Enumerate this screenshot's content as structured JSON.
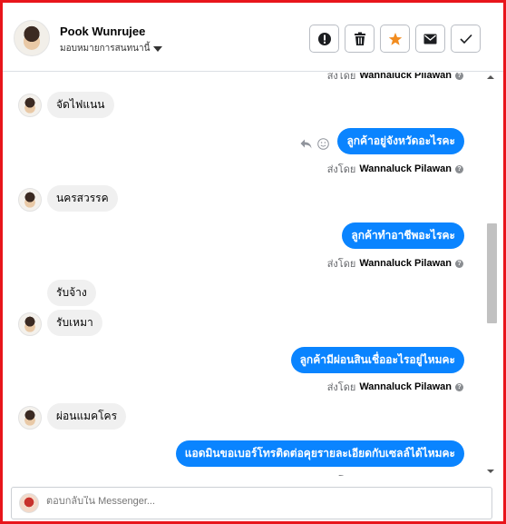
{
  "header": {
    "contact_name": "Pook Wunrujee",
    "assign_label": "มอบหมายการสนทนานี้",
    "actions": [
      "report-icon",
      "trash-icon",
      "star-icon",
      "mail-icon",
      "check-icon"
    ],
    "star_color": "#f28c1f"
  },
  "thread": {
    "sender_prefix": "ส่งโดย",
    "sender_name": "Wannaluck Pilawan",
    "messages": [
      {
        "dir": "in",
        "text": "จัดไฟแนน"
      },
      {
        "dir": "out",
        "text": "ลูกค้าอยู่จังหวัดอะไรคะ"
      },
      {
        "dir": "in",
        "text": "นครสวรรค"
      },
      {
        "dir": "out",
        "text": "ลูกค้าทำอาชีพอะไรคะ"
      },
      {
        "dir": "in",
        "text": "รับจ้าง"
      },
      {
        "dir": "in",
        "text": "รับเหมา"
      },
      {
        "dir": "out",
        "text": "ลูกค้ามีผ่อนสินเชื่ออะไรอยู่ไหมคะ"
      },
      {
        "dir": "in",
        "text": "ผ่อนแมคโคร"
      },
      {
        "dir": "out",
        "text": "แอดมินขอเบอร์โทรติดต่อคุยรายละเอียดกับเซลล์ได้ไหมคะ"
      }
    ],
    "bubble_out_color": "#0a84ff",
    "bubble_in_color": "#f0f0f0"
  },
  "composer": {
    "placeholder": "ตอบกลับใน Messenger..."
  }
}
